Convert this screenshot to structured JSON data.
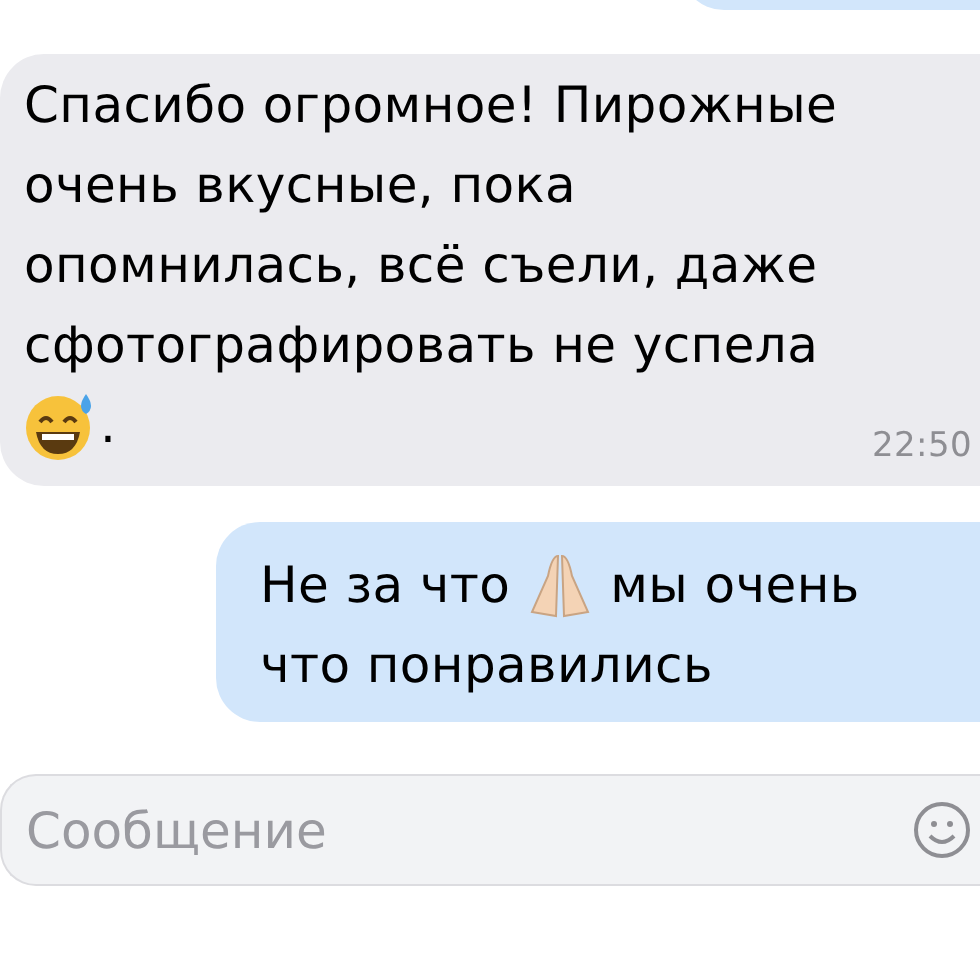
{
  "messages": [
    {
      "kind": "cut-off"
    },
    {
      "kind": "incoming",
      "text": "Спасибо огромное! Пирожные\nочень вкусные, пока\nопомнилась, всё съели, даже\nсфотографировать не успела",
      "after_emoji": ".",
      "time": "22:50"
    },
    {
      "kind": "outgoing",
      "before_icon": "Не за что",
      "after_icon": "мы очень",
      "line_2": "что понравились"
    }
  ],
  "composer": {
    "placeholder": "Сообщение"
  }
}
